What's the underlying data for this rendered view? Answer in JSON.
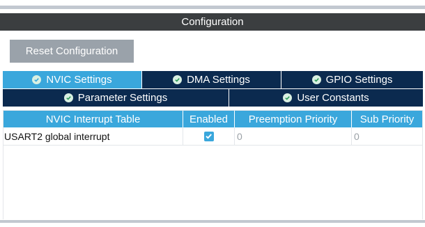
{
  "panel": {
    "title": "Configuration"
  },
  "toolbar": {
    "reset_label": "Reset Configuration"
  },
  "tabs": [
    {
      "label": "NVIC Settings",
      "active": true
    },
    {
      "label": "DMA Settings",
      "active": false
    },
    {
      "label": "GPIO Settings",
      "active": false
    },
    {
      "label": "Parameter Settings",
      "active": false
    },
    {
      "label": "User Constants",
      "active": false
    }
  ],
  "table": {
    "headers": [
      "NVIC Interrupt Table",
      "Enabled",
      "Preemption Priority",
      "Sub Priority"
    ],
    "rows": [
      {
        "name": "USART2 global interrupt",
        "enabled": true,
        "preemption": "0",
        "sub": "0"
      }
    ]
  },
  "colors": {
    "title_bar": "#3b3e40",
    "tab_active": "#3aa7dc",
    "tab_inactive": "#0b2a4f",
    "button": "#9aa2aa"
  },
  "icons": {
    "tab_check": "check-circle-icon",
    "row_checkbox": "checkbox-checked-icon"
  }
}
